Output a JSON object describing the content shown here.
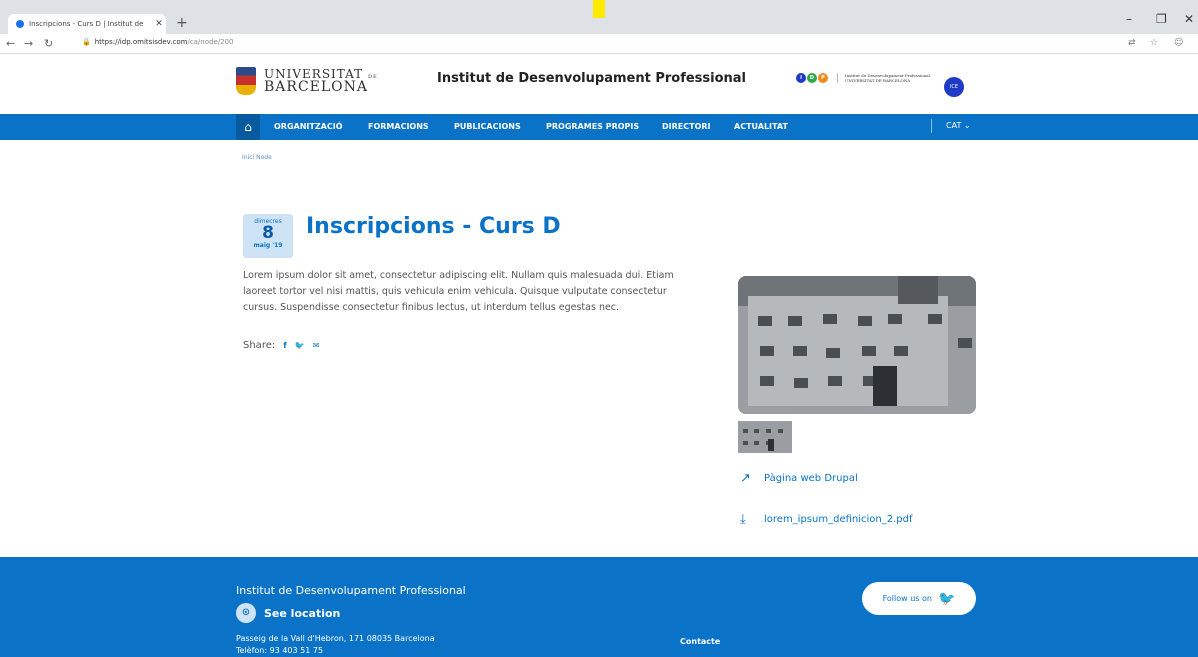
{
  "browser": {
    "tab_title": "Inscripcions - Curs D | Institut de",
    "url_host": "https://idp.omitsisdev.com",
    "url_path": "/ca/node/200"
  },
  "header": {
    "ub_line1": "UNIVERSITAT",
    "ub_line1_small": "DE",
    "ub_line2": "BARCELONA",
    "site_title": "Institut de Desenvolupament Professional",
    "idp_text": "Institut de Desenvolupament Professional UNIVERSITAT DE BARCELONA",
    "ice_label": "ICE"
  },
  "nav": {
    "items": [
      "ORGANITZACIÓ",
      "FORMACIONS",
      "PUBLICACIONS",
      "PROGRAMES PROPIS",
      "DIRECTORI",
      "ACTUALITAT"
    ],
    "lang": "CAT"
  },
  "breadcrumb": "Inici Node",
  "article": {
    "date_weekday": "dimecres",
    "date_day": "8",
    "date_month": "maig '19",
    "title": "Inscripcions - Curs D",
    "body": "Lorem ipsum dolor sit amet, consectetur adipiscing elit. Nullam quis malesuada dui. Etiam laoreet tortor vel nisi mattis, quis vehicula enim vehicula. Quisque vulputate consectetur cursus. Suspendisse consectetur finibus lectus, ut interdum tellus egestas nec.",
    "share_label": "Share:",
    "link_label": "Pàgina web Drupal",
    "file_label": "lorem_ipsum_definicion_2.pdf"
  },
  "footer": {
    "title": "Institut de Desenvolupament Professional",
    "location": "See location",
    "address": "Passeig de la Vall d'Hebron, 171 08035 Barcelona",
    "phone": "Telèfon: 93 403 51 75",
    "contact": "Contacte",
    "follow": "Follow us on"
  },
  "colors": {
    "brand_blue": "#0a73c8",
    "footer_blue": "#0a73c8"
  }
}
